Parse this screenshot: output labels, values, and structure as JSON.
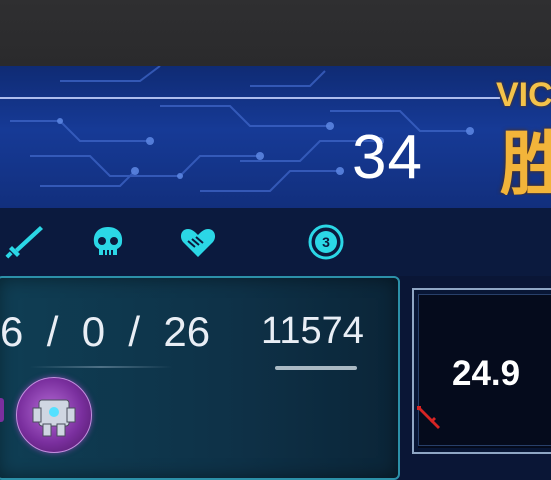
{
  "header": {
    "score": "34",
    "victory_en": "VIC",
    "victory_cn": "胜"
  },
  "icons": [
    "sword-icon",
    "skull-icon",
    "handshake-heart-icon",
    "coin-icon"
  ],
  "stats": {
    "kda_text": "6  /  0  /  26",
    "kills": "6",
    "deaths": "0",
    "assists": "26",
    "gold": "11574"
  },
  "damage": {
    "value": "24.9"
  },
  "colors": {
    "accent_cyan": "#2bd7e6",
    "victory_gold": "#f2b43a",
    "item_purple": "#7a2f9e"
  }
}
